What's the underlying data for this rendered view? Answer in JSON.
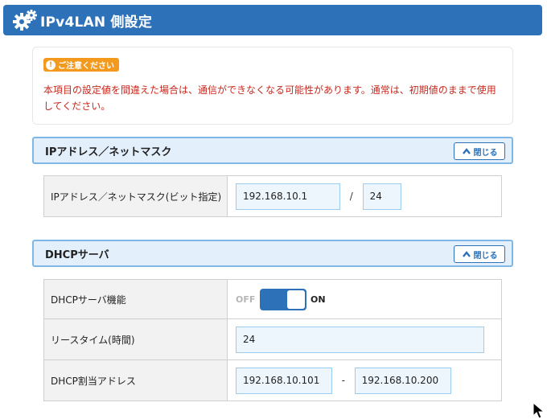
{
  "header": {
    "title": "IPv4LAN 側設定",
    "icon": "gears-icon",
    "bg_color": "#2d72b8"
  },
  "notice": {
    "badge": "ご注意ください",
    "text": "本項目の設定値を間違えた場合は、通信ができなくなる可能性があります。通常は、初期値のままで使用してください。",
    "text_color": "#c8281d",
    "badge_color": "#f39a1e"
  },
  "ip_section": {
    "title": "IPアドレス／ネットマスク",
    "close_label": "閉じる",
    "row_label": "IPアドレス／ネットマスク(ビット指定)",
    "ip_value": "192.168.10.1",
    "separator": "/",
    "mask_value": "24"
  },
  "dhcp_section": {
    "title": "DHCPサーバ",
    "close_label": "閉じる",
    "rows": {
      "function_label": "DHCPサーバ機能",
      "toggle_off": "OFF",
      "toggle_on": "ON",
      "toggle_state": "ON",
      "lease_label": "リースタイム(時間)",
      "lease_value": "24",
      "range_label": "DHCP割当アドレス",
      "range_start": "192.168.10.101",
      "range_sep": "-",
      "range_end": "192.168.10.200"
    }
  }
}
